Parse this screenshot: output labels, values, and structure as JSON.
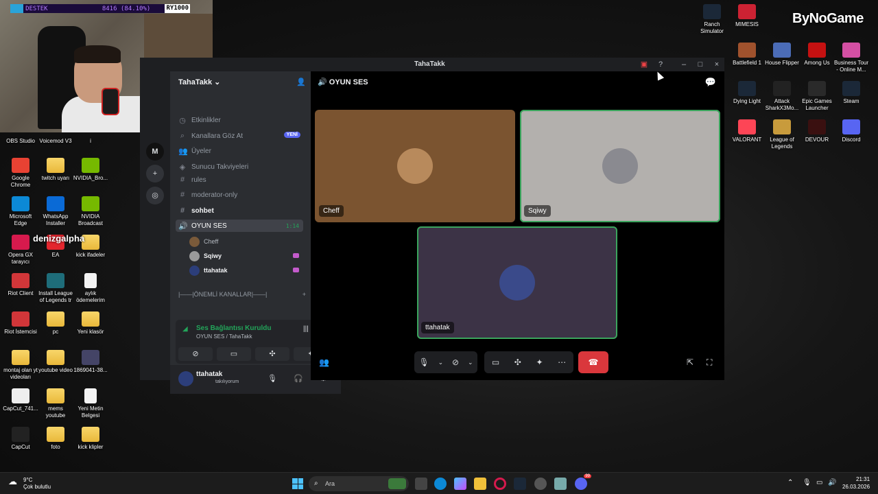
{
  "overlay": {
    "label": "DESTEK",
    "value": "8416 (84.10%)",
    "rank": "RY1000",
    "watermark": "ByNoGame"
  },
  "desktop_left": [
    {
      "label": "OBS Studio",
      "color": "#333"
    },
    {
      "label": "Voicemod V3",
      "color": "#333"
    },
    {
      "label": "i",
      "color": "#333"
    },
    {
      "label": "Google Chrome",
      "color": "#e84233"
    },
    {
      "label": "twitch uyarı",
      "color": "folder"
    },
    {
      "label": "NVIDIA_Bro...",
      "color": "#76b900"
    },
    {
      "label": "Microsoft Edge",
      "color": "#0c89d6"
    },
    {
      "label": "WhatsApp Installer",
      "color": "#0a6ad6"
    },
    {
      "label": "NVIDIA Broadcast",
      "color": "#76b900"
    },
    {
      "label": "Opera GX tarayıcı",
      "color": "#d61a4d"
    },
    {
      "label": "EA",
      "color": "#e3262e"
    },
    {
      "label": "kick ifadeler",
      "color": "folder"
    },
    {
      "label": "Riot Client",
      "color": "#d13639"
    },
    {
      "label": "Install League of Legends tr",
      "color": "#1e6d7a"
    },
    {
      "label": "aylık ödemelerim",
      "color": "doc"
    },
    {
      "label": "Riot İstemcisi",
      "color": "#d13639"
    },
    {
      "label": "pc",
      "color": "folder"
    },
    {
      "label": "Yeni klasör",
      "color": "folder"
    },
    {
      "label": "montaj olan yt videoları",
      "color": "folder"
    },
    {
      "label": "youtube video",
      "color": "folder"
    },
    {
      "label": "1869041-38...",
      "color": "#444466"
    },
    {
      "label": "CapCut_741...",
      "color": "#eeeeee"
    },
    {
      "label": "mems youtube",
      "color": "folder"
    },
    {
      "label": "Yeni Metin Belgesi",
      "color": "doc"
    },
    {
      "label": "CapCut",
      "color": "#222"
    },
    {
      "label": "foto",
      "color": "folder"
    },
    {
      "label": "kick klipler",
      "color": "folder"
    }
  ],
  "denizgalpha_text": "denizgalpha",
  "desktop_right": [
    {
      "label": "Ranch Simulator",
      "color": "#1b2838"
    },
    {
      "label": "MIMESIS",
      "color": "#c23"
    },
    {
      "label": "Battlefield 1",
      "color": "#a0522d"
    },
    {
      "label": "House Flipper",
      "color": "#4b6cb7"
    },
    {
      "label": "Among Us",
      "color": "#c51111"
    },
    {
      "label": "Business Tour - Online M...",
      "color": "#d44fa3"
    },
    {
      "label": "Dying Light",
      "color": "#1b2838"
    },
    {
      "label": "Attack SharkX3Mo...",
      "color": "#222"
    },
    {
      "label": "Epic Games Launcher",
      "color": "#2a2a2a"
    },
    {
      "label": "Steam",
      "color": "#1b2838"
    },
    {
      "label": "VALORANT",
      "color": "#fd4556"
    },
    {
      "label": "League of Legends",
      "color": "#c89b3c"
    },
    {
      "label": "DEVOUR",
      "color": "#3a1010"
    },
    {
      "label": "Discord",
      "color": "#5865f2"
    }
  ],
  "discord": {
    "window_title": "TahaTakk",
    "server_name": "TahaTakk",
    "top_items": [
      {
        "label": "Etkinlikler"
      },
      {
        "label": "Kanallara Göz At",
        "badge": "YENİ"
      },
      {
        "label": "Üyeler"
      },
      {
        "label": "Sunucu Takviyeleri"
      }
    ],
    "channels": [
      {
        "label": "rules",
        "icon": "#"
      },
      {
        "label": "moderator-only",
        "icon": "#"
      },
      {
        "label": "sohbet",
        "icon": "#"
      },
      {
        "label": "OYUN SES",
        "icon": "🔊",
        "time": "1:14"
      }
    ],
    "voice_users": [
      {
        "name": "Cheff",
        "stream": false,
        "color": "#7a5a3a"
      },
      {
        "name": "Sqiwy",
        "stream": true,
        "color": "#9a9a9a"
      },
      {
        "name": "ttahatak",
        "stream": true,
        "color": "#2c3e7a"
      }
    ],
    "category": "|——|ÖNEMLİ KANALLAR|——|",
    "voice_status": "Ses Bağlantısı Kuruldu",
    "voice_location": "OYUN SES / TahaTakk",
    "user_name": "ttahatak",
    "user_status": "takılıyorum",
    "stage_title": "OYUN SES",
    "tiles": [
      {
        "name": "Cheff",
        "bg": "#7b5430",
        "avatar": "#b88a5c"
      },
      {
        "name": "Sqiwy",
        "bg": "#b3b0ad",
        "avatar": "#8a8a90"
      },
      {
        "name": "ttahatak",
        "bg": "#3c3346",
        "avatar": "#3a4a8a"
      }
    ]
  },
  "taskbar": {
    "weather_temp": "9°C",
    "weather_desc": "Çok bulutlu",
    "search_placeholder": "Ara",
    "time": "21:31",
    "date": "26.03.2026",
    "discord_badge": "99"
  }
}
